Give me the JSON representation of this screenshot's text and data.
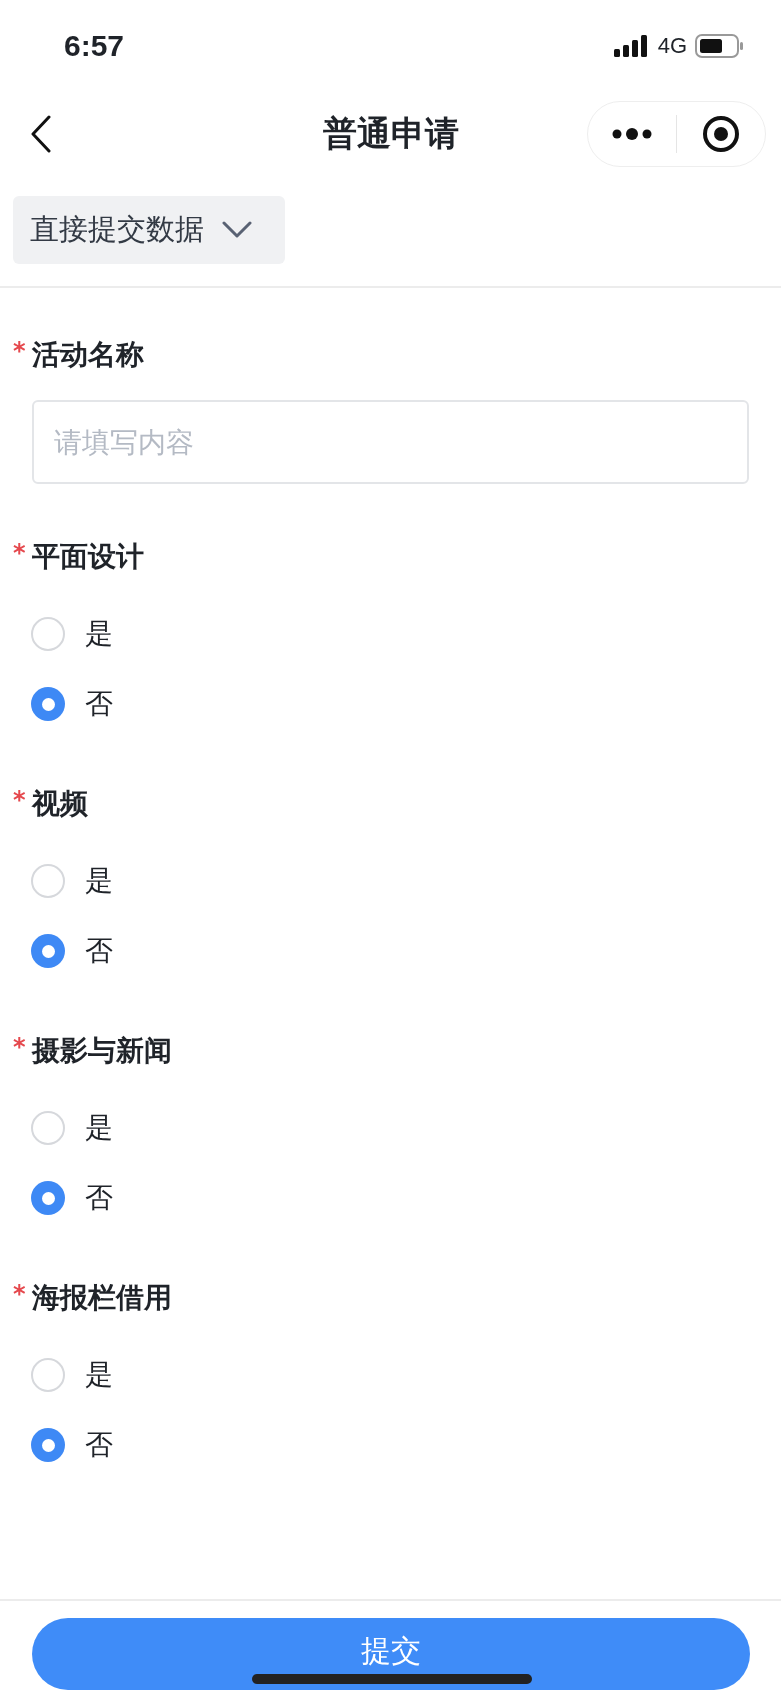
{
  "status_bar": {
    "time": "6:57",
    "network": "4G"
  },
  "nav": {
    "title": "普通申请"
  },
  "mode_dropdown": {
    "label": "直接提交数据"
  },
  "fields": [
    {
      "kind": "text",
      "required_mark": "*",
      "label": "活动名称",
      "placeholder": "请填写内容"
    },
    {
      "kind": "radio",
      "required_mark": "*",
      "label": "平面设计",
      "options": [
        {
          "label": "是",
          "selected": false
        },
        {
          "label": "否",
          "selected": true
        }
      ]
    },
    {
      "kind": "radio",
      "required_mark": "*",
      "label": "视频",
      "options": [
        {
          "label": "是",
          "selected": false
        },
        {
          "label": "否",
          "selected": true
        }
      ]
    },
    {
      "kind": "radio",
      "required_mark": "*",
      "label": "摄影与新闻",
      "options": [
        {
          "label": "是",
          "selected": false
        },
        {
          "label": "否",
          "selected": true
        }
      ]
    },
    {
      "kind": "radio",
      "required_mark": "*",
      "label": "海报栏借用",
      "options": [
        {
          "label": "是",
          "selected": false
        },
        {
          "label": "否",
          "selected": true
        }
      ]
    }
  ],
  "submit_button": {
    "label": "提交"
  }
}
